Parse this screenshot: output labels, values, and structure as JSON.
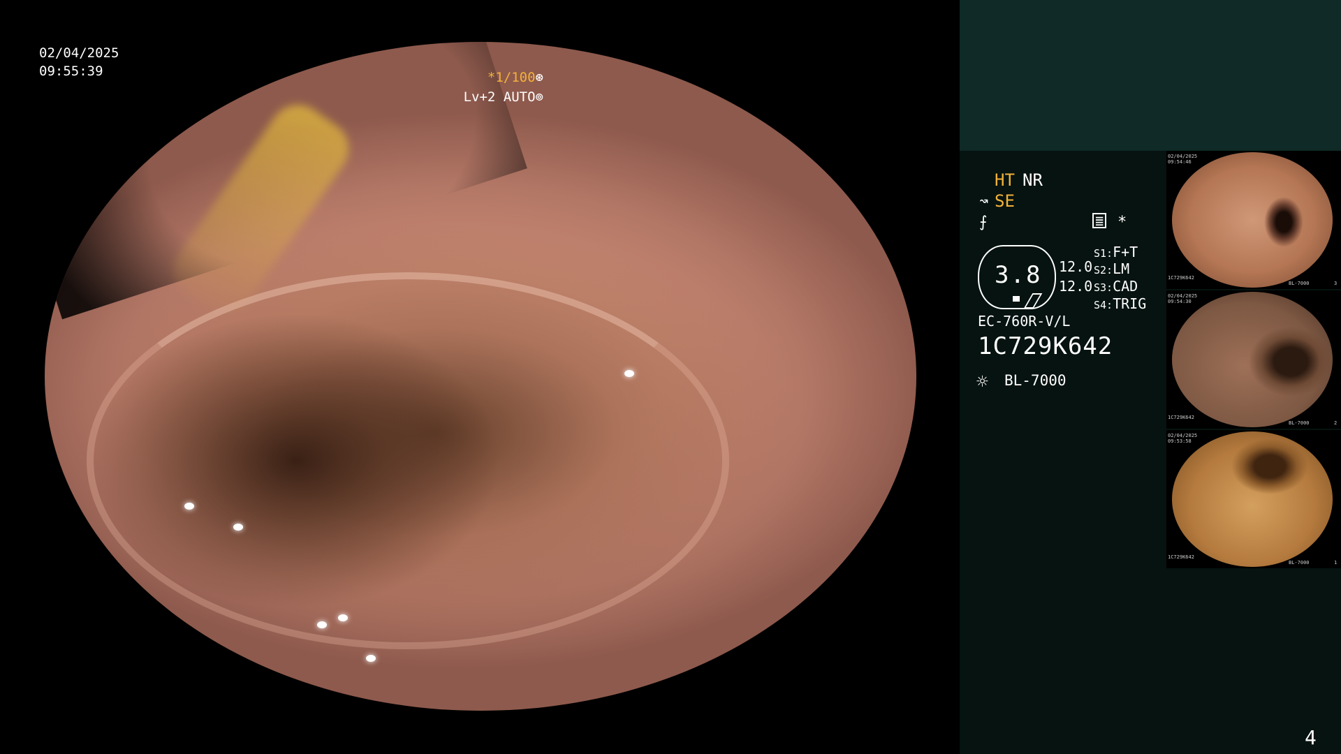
{
  "overlay": {
    "date": "02/04/2025",
    "time": "09:55:39",
    "shutter": "*1/100",
    "shutter_icon": "⊛",
    "level": "Lv+2 AUTO",
    "level_icon": "⊚"
  },
  "panel": {
    "ht": "HT",
    "nr": "NR",
    "se": "SE",
    "se_icon": "↝",
    "s3_icon": "⨍",
    "gear": "≣",
    "star": "*",
    "zoom_value": "3.8",
    "values": [
      "12.0",
      "12.0"
    ],
    "scopes": [
      {
        "label": "S1:",
        "value": "F+T"
      },
      {
        "label": "S2:",
        "value": "LM"
      },
      {
        "label": "S3:",
        "value": "CAD"
      },
      {
        "label": "S4:",
        "value": "TRIG"
      }
    ],
    "model": "EC-760R-V/L",
    "serial": "1C729K642",
    "light_icon": "☼",
    "light": "BL-7000",
    "page_number": "4"
  },
  "thumbnails": [
    {
      "date": "02/04/2025",
      "time": "09:54:46",
      "id": "1C729K642",
      "light": "BL-7000",
      "index": "3"
    },
    {
      "date": "02/04/2025",
      "time": "09:54:30",
      "id": "1C729K642",
      "light": "BL-7000",
      "index": "2"
    },
    {
      "date": "02/04/2025",
      "time": "09:53:58",
      "id": "1C729K642",
      "light": "BL-7000",
      "index": "1"
    }
  ]
}
